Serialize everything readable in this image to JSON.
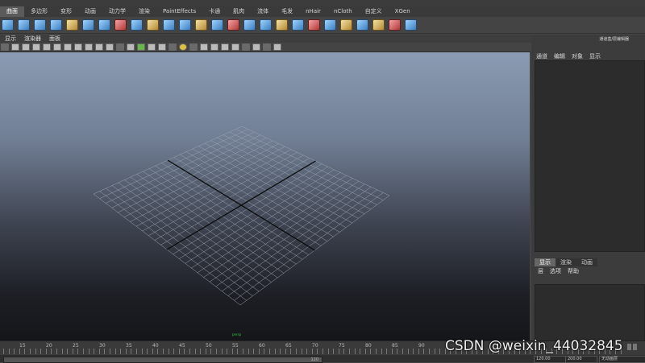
{
  "shelf_tabs": [
    {
      "label": "曲面",
      "active": true
    },
    {
      "label": "多边形"
    },
    {
      "label": "变形"
    },
    {
      "label": "动画"
    },
    {
      "label": "动力学"
    },
    {
      "label": "渲染"
    },
    {
      "label": "PaintEffects"
    },
    {
      "label": "卡通"
    },
    {
      "label": "肌肉"
    },
    {
      "label": "流体"
    },
    {
      "label": "毛发"
    },
    {
      "label": "nHair"
    },
    {
      "label": "nCloth"
    },
    {
      "label": "自定义"
    },
    {
      "label": "XGen"
    }
  ],
  "panel_menu": [
    "显示",
    "渲染器",
    "面板"
  ],
  "viewport": {
    "camera_label": "persp"
  },
  "side_panel": {
    "title": "通道盒/层编辑器",
    "menu": [
      "通道",
      "编辑",
      "对象",
      "显示"
    ],
    "layer_tabs": [
      {
        "label": "显示",
        "active": true
      },
      {
        "label": "渲染"
      },
      {
        "label": "动画"
      }
    ],
    "layer_menu": [
      "层",
      "选项",
      "帮助"
    ]
  },
  "timeline": {
    "ticks": [
      "15",
      "20",
      "25",
      "30",
      "35",
      "40",
      "45",
      "50",
      "55",
      "60",
      "65",
      "70",
      "75",
      "80",
      "85",
      "90"
    ],
    "range_start": "120.00",
    "range_end": "200.00",
    "range_end_small": "120",
    "auto_key": "无动画层"
  },
  "watermark": "CSDN @weixin_44032845"
}
